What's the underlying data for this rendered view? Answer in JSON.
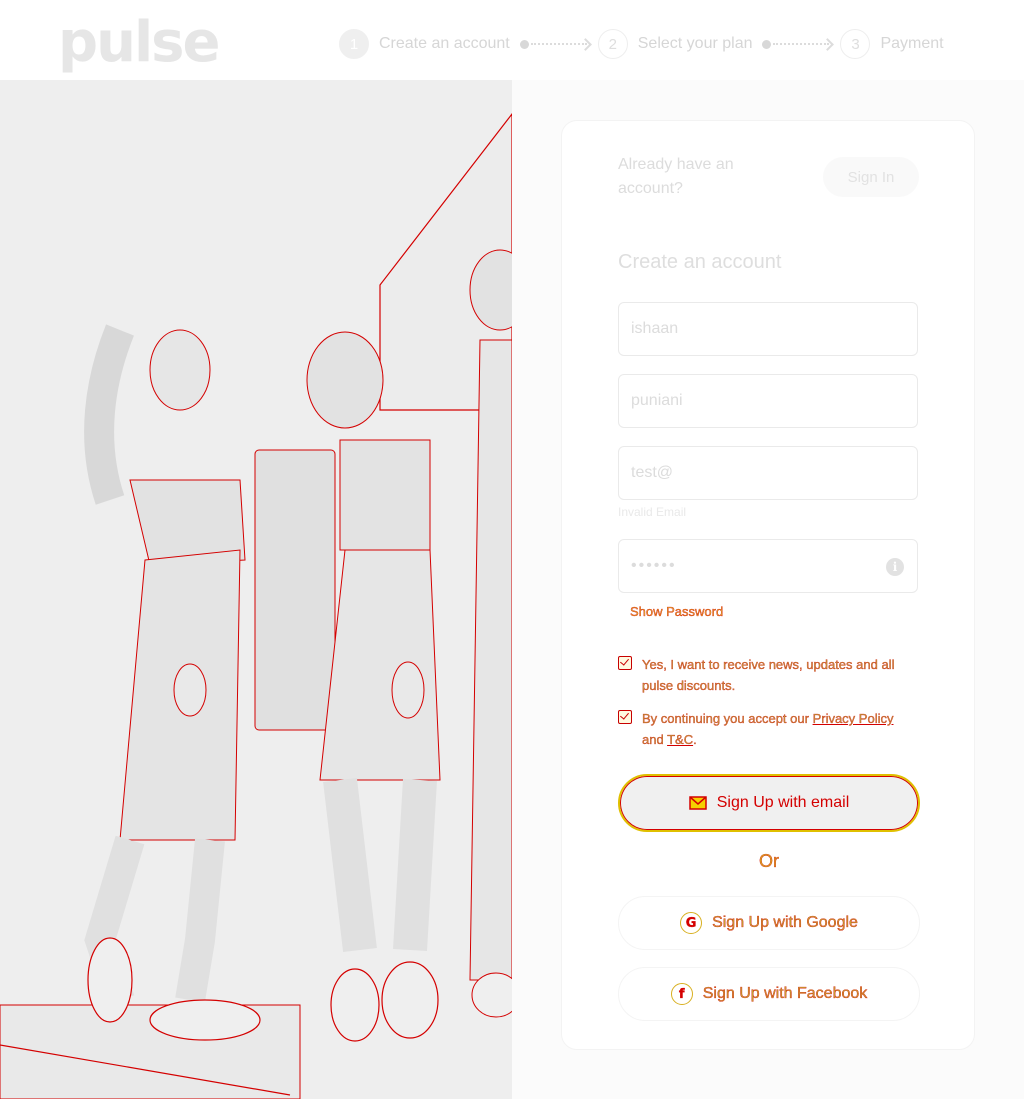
{
  "brand": {
    "logo": "pulse"
  },
  "steps": [
    {
      "number": "1",
      "label": "Create an account",
      "active": true
    },
    {
      "number": "2",
      "label": "Select your plan",
      "active": false
    },
    {
      "number": "3",
      "label": "Payment",
      "active": false
    }
  ],
  "signin_prompt": {
    "text": "Already have an account?",
    "button": "Sign In"
  },
  "form": {
    "title": "Create an account",
    "first_name": "ishaan",
    "last_name": "puniani",
    "email": "test@",
    "email_error": "Invalid Email",
    "password": "••••••",
    "show_password": "Show Password",
    "consent_news": "Yes, I want to receive news, updates and all pulse discounts.",
    "consent_terms_prefix": "By continuing you accept our ",
    "consent_terms_privacy": "Privacy Policy",
    "consent_terms_and": " and ",
    "consent_terms_tc": "T&C",
    "consent_terms_suffix": "."
  },
  "buttons": {
    "email": "Sign Up with email",
    "or": "Or",
    "google": "Sign Up with Google",
    "facebook": "Sign Up with Facebook"
  },
  "colors": {
    "accent": "#d40000",
    "highlight": "#e0c000"
  }
}
